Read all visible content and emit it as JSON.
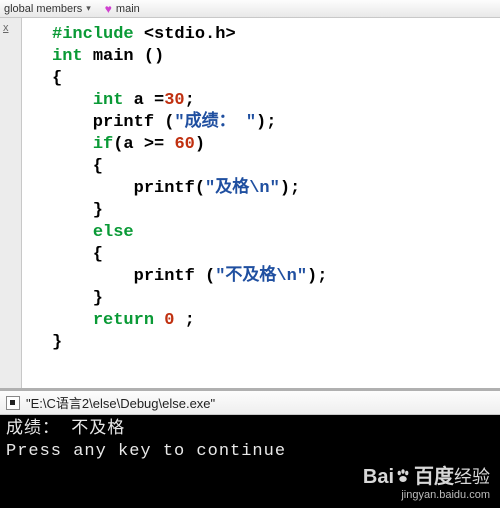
{
  "toolbar": {
    "left_text": "global members",
    "right_text": "main"
  },
  "editor": {
    "code_tokens": [
      [
        {
          "t": "#include ",
          "c": "pp"
        },
        {
          "t": "<stdio.h>",
          "c": "inc"
        }
      ],
      [
        {
          "t": "int ",
          "c": "kw"
        },
        {
          "t": "main ",
          "c": "fn"
        },
        {
          "t": "()",
          "c": "norm"
        }
      ],
      [
        {
          "t": "{",
          "c": "norm"
        }
      ],
      [
        {
          "t": "    ",
          "c": "norm"
        },
        {
          "t": "int ",
          "c": "kw"
        },
        {
          "t": "a ",
          "c": "norm"
        },
        {
          "t": "=",
          "c": "norm"
        },
        {
          "t": "30",
          "c": "num"
        },
        {
          "t": ";",
          "c": "norm"
        }
      ],
      [
        {
          "t": "    printf (",
          "c": "norm"
        },
        {
          "t": "\"成绩： \"",
          "c": "str"
        },
        {
          "t": ");",
          "c": "norm"
        }
      ],
      [
        {
          "t": "    ",
          "c": "norm"
        },
        {
          "t": "if",
          "c": "kw"
        },
        {
          "t": "(a >= ",
          "c": "norm"
        },
        {
          "t": "60",
          "c": "num"
        },
        {
          "t": ")",
          "c": "norm"
        }
      ],
      [
        {
          "t": "    {",
          "c": "norm"
        }
      ],
      [
        {
          "t": "        printf(",
          "c": "norm"
        },
        {
          "t": "\"及格\\n\"",
          "c": "str"
        },
        {
          "t": ");",
          "c": "norm"
        }
      ],
      [
        {
          "t": "    }",
          "c": "norm"
        }
      ],
      [
        {
          "t": "    ",
          "c": "norm"
        },
        {
          "t": "else",
          "c": "kw"
        }
      ],
      [
        {
          "t": "    {",
          "c": "norm"
        }
      ],
      [
        {
          "t": "        printf (",
          "c": "norm"
        },
        {
          "t": "\"不及格\\n\"",
          "c": "str"
        },
        {
          "t": ");",
          "c": "norm"
        }
      ],
      [
        {
          "t": "    }",
          "c": "norm"
        }
      ],
      [
        {
          "t": "    ",
          "c": "norm"
        },
        {
          "t": "return ",
          "c": "kw"
        },
        {
          "t": "0 ",
          "c": "num"
        },
        {
          "t": ";",
          "c": "norm"
        }
      ],
      [
        {
          "t": "}",
          "c": "norm"
        }
      ]
    ]
  },
  "console": {
    "title": "\"E:\\C语言2\\else\\Debug\\else.exe\"",
    "line1": "成绩： 不及格",
    "line2": "Press any key to continue"
  },
  "watermark": {
    "brand_en": "Bai",
    "brand_cn": "百度",
    "brand_suffix": "经验",
    "url": "jingyan.baidu.com"
  }
}
